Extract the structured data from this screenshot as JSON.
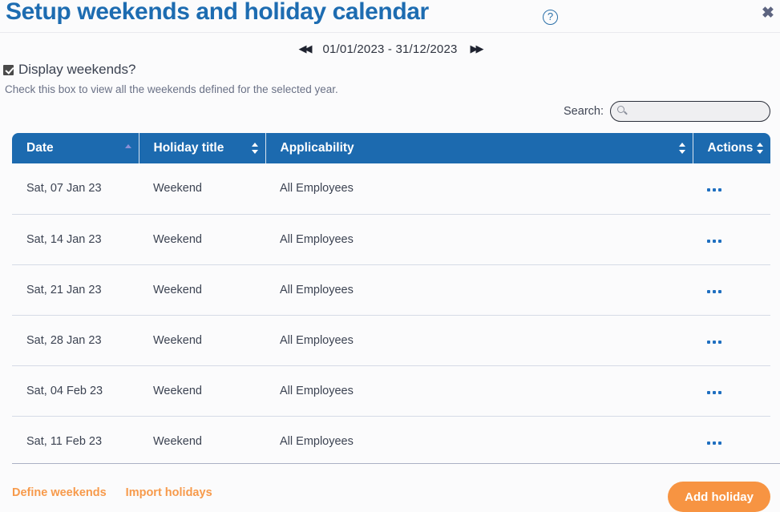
{
  "header": {
    "title": "Setup weekends and holiday calendar",
    "help_icon": "question-mark-circle-icon",
    "close_label": "✖"
  },
  "date_nav": {
    "prev_label": "◀◀",
    "next_label": "▶▶",
    "range": "01/01/2023 - 31/12/2023"
  },
  "weekends": {
    "checkbox_label": "Display weekends?",
    "checked": true,
    "hint": "Check this box to view all the weekends defined for the selected year."
  },
  "search": {
    "label": "Search:",
    "value": "",
    "placeholder": "",
    "icon": "search-icon"
  },
  "table": {
    "columns": [
      {
        "label": "Date",
        "sort": "asc"
      },
      {
        "label": "Holiday title",
        "sort": "none"
      },
      {
        "label": "Applicability",
        "sort": "none"
      },
      {
        "label": "Actions",
        "sort": "none"
      }
    ],
    "rows": [
      {
        "date": "Sat, 07 Jan 23",
        "title": "Weekend",
        "applicability": "All Employees",
        "actions": "…"
      },
      {
        "date": "Sat, 14 Jan 23",
        "title": "Weekend",
        "applicability": "All Employees",
        "actions": "…"
      },
      {
        "date": "Sat, 21 Jan 23",
        "title": "Weekend",
        "applicability": "All Employees",
        "actions": "…"
      },
      {
        "date": "Sat, 28 Jan 23",
        "title": "Weekend",
        "applicability": "All Employees",
        "actions": "…"
      },
      {
        "date": "Sat, 04 Feb 23",
        "title": "Weekend",
        "applicability": "All Employees",
        "actions": "…"
      },
      {
        "date": "Sat, 11 Feb 23",
        "title": "Weekend",
        "applicability": "All Employees",
        "actions": "…"
      }
    ]
  },
  "footer": {
    "define_weekends": "Define weekends",
    "import_holidays": "Import holidays",
    "add_holiday": "Add holiday"
  },
  "colors": {
    "title_blue": "#1d6cb1",
    "header_blue": "#1c6aaf",
    "accent_orange": "#f79442",
    "link_orange": "#f79a4b",
    "row_text": "#3c4352"
  }
}
